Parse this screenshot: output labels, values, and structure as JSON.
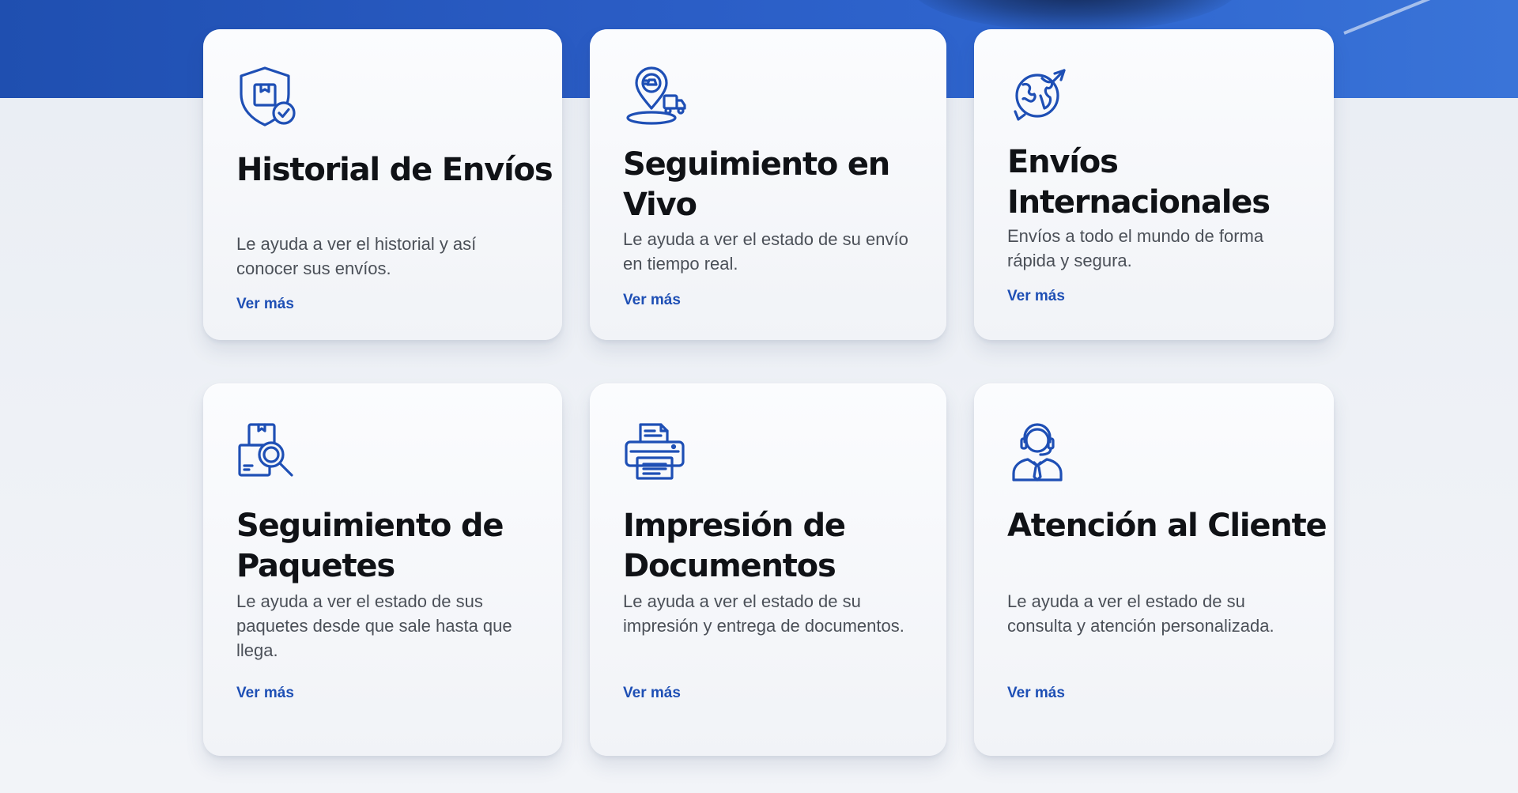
{
  "hero": {
    "image": "vehicle-background"
  },
  "accent_color": "#1e4fb5",
  "cards": [
    {
      "icon": "shield-package-check-icon",
      "title": "Historial de Envíos",
      "description": "Le ayuda a ver el historial y así conocer sus envíos.",
      "link": "Ver más"
    },
    {
      "icon": "location-pin-truck-icon",
      "title": "Seguimiento en Vivo",
      "description": "Le ayuda a ver el estado de su envío en tiempo real.",
      "link": "Ver más"
    },
    {
      "icon": "globe-arrows-icon",
      "title": "Envíos Internacionales",
      "description": "Envíos a todo el mundo de forma rápida y segura.",
      "link": "Ver más"
    },
    {
      "icon": "package-search-icon",
      "title": "Seguimiento de Paquetes",
      "description": "Le ayuda a ver el estado de sus paquetes desde que sale hasta que llega.",
      "link": "Ver más"
    },
    {
      "icon": "printer-icon",
      "title": "Impresión de Documentos",
      "description": "Le ayuda a ver el estado de su impresión y entrega de documentos.",
      "link": "Ver más"
    },
    {
      "icon": "customer-support-headset-icon",
      "title": "Atención al Cliente",
      "description": "Le ayuda a ver el estado de su consulta y atención personalizada.",
      "link": "Ver más"
    }
  ]
}
